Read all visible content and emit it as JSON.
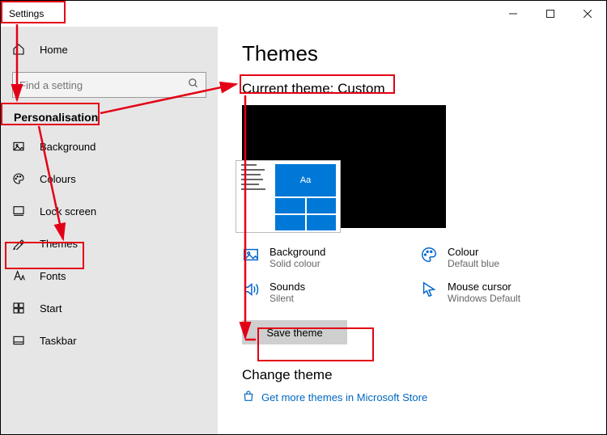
{
  "window": {
    "title": "Settings"
  },
  "home_label": "Home",
  "search": {
    "placeholder": "Find a setting"
  },
  "section_header": "Personalisation",
  "sidebar": {
    "items": [
      {
        "label": "Background"
      },
      {
        "label": "Colours"
      },
      {
        "label": "Lock screen"
      },
      {
        "label": "Themes"
      },
      {
        "label": "Fonts"
      },
      {
        "label": "Start"
      },
      {
        "label": "Taskbar"
      }
    ]
  },
  "page": {
    "heading": "Themes",
    "current_theme": "Current theme: Custom",
    "preview_sample_text": "Aa",
    "options": {
      "background": {
        "title": "Background",
        "subtitle": "Solid colour"
      },
      "colour": {
        "title": "Colour",
        "subtitle": "Default blue"
      },
      "sounds": {
        "title": "Sounds",
        "subtitle": "Silent"
      },
      "cursor": {
        "title": "Mouse cursor",
        "subtitle": "Windows Default"
      }
    },
    "save_button": "Save theme",
    "change_theme": "Change theme",
    "store_link": "Get more themes in Microsoft Store"
  }
}
